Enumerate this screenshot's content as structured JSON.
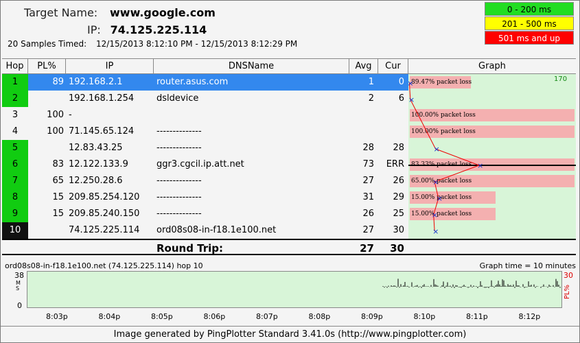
{
  "header": {
    "target_label": "Target Name:",
    "target_value": "www.google.com",
    "ip_label": "IP:",
    "ip_value": "74.125.225.114",
    "samples_label": "20 Samples Timed:",
    "samples_value": "12/15/2013 8:12:10 PM - 12/15/2013 8:12:29 PM"
  },
  "legend": {
    "green": "0 - 200 ms",
    "yellow": "201 - 500 ms",
    "red": "501 ms and up"
  },
  "columns": {
    "hop": "Hop",
    "pl": "PL%",
    "ip": "IP",
    "dns": "DNSName",
    "avg": "Avg",
    "cur": "Cur",
    "graph": "Graph"
  },
  "graph_scale_label": "170",
  "rows": [
    {
      "hop": "1",
      "pl": "89",
      "ip": "192.168.2.1",
      "dns": "router.asus.com",
      "avg": "1",
      "cur": "0",
      "loss": "89.47% packet loss",
      "lossw": 0.37,
      "selected": true,
      "hopc": "green"
    },
    {
      "hop": "2",
      "pl": "",
      "ip": "192.168.1.254",
      "dns": "dsldevice",
      "avg": "2",
      "cur": "6",
      "loss": "",
      "lossw": 0,
      "selected": false,
      "hopc": "green"
    },
    {
      "hop": "3",
      "pl": "100",
      "ip": "-",
      "dns": "",
      "avg": "",
      "cur": "",
      "loss": "100.00% packet loss",
      "lossw": 1.0,
      "selected": false,
      "hopc": "none"
    },
    {
      "hop": "4",
      "pl": "100",
      "ip": "71.145.65.124",
      "dns": "--------------",
      "avg": "",
      "cur": "",
      "loss": "100.00% packet loss",
      "lossw": 1.0,
      "selected": false,
      "hopc": "none"
    },
    {
      "hop": "5",
      "pl": "",
      "ip": "12.83.43.25",
      "dns": "--------------",
      "avg": "28",
      "cur": "28",
      "loss": "",
      "lossw": 0,
      "selected": false,
      "hopc": "green"
    },
    {
      "hop": "6",
      "pl": "83",
      "ip": "12.122.133.9",
      "dns": "ggr3.cgcil.ip.att.net",
      "avg": "73",
      "cur": "ERR",
      "loss": "83.33% packet loss",
      "lossw": 1.0,
      "selected": false,
      "hopc": "green"
    },
    {
      "hop": "7",
      "pl": "65",
      "ip": "12.250.28.6",
      "dns": "--------------",
      "avg": "27",
      "cur": "26",
      "loss": "65.00% packet loss",
      "lossw": 1.0,
      "selected": false,
      "hopc": "green"
    },
    {
      "hop": "8",
      "pl": "15",
      "ip": "209.85.254.120",
      "dns": "--------------",
      "avg": "31",
      "cur": "29",
      "loss": "15.00% packet loss",
      "lossw": 0.52,
      "selected": false,
      "hopc": "green"
    },
    {
      "hop": "9",
      "pl": "15",
      "ip": "209.85.240.150",
      "dns": "--------------",
      "avg": "26",
      "cur": "25",
      "loss": "15.00% packet loss",
      "lossw": 0.52,
      "selected": false,
      "hopc": "green"
    },
    {
      "hop": "10",
      "pl": "",
      "ip": "74.125.225.114",
      "dns": "ord08s08-in-f18.1e100.net",
      "avg": "27",
      "cur": "30",
      "loss": "",
      "lossw": 0,
      "selected": false,
      "hopc": "black"
    }
  ],
  "round_trip": {
    "label": "Round Trip:",
    "avg": "27",
    "cur": "30"
  },
  "lower": {
    "title": "ord08s08-in-f18.1e100.net (74.125.225.114) hop 10",
    "time_label": "Graph time = 10 minutes",
    "y_max": "38",
    "y_min": "0",
    "y_unit": "MS",
    "pl_max": "30",
    "pl_label": "PL%",
    "ticks": [
      "8:03p",
      "8:04p",
      "8:05p",
      "8:06p",
      "8:07p",
      "8:08p",
      "8:09p",
      "8:10p",
      "8:11p",
      "8:12p"
    ]
  },
  "footer": "Image generated by PingPlotter Standard 3.41.0s (http://www.pingplotter.com)"
}
